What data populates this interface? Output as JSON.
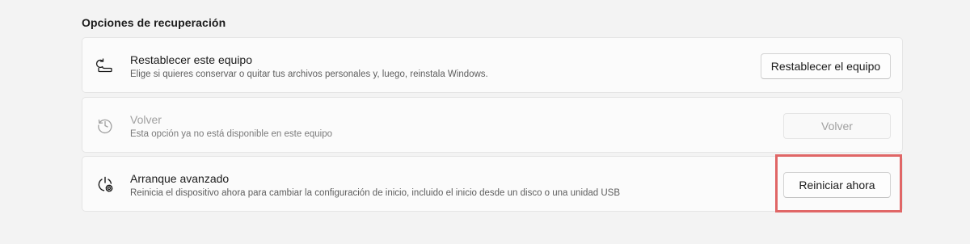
{
  "section": {
    "title": "Opciones de recuperación"
  },
  "cards": [
    {
      "icon": "reset-pc-icon",
      "title": "Restablecer este equipo",
      "description": "Elige si quieres conservar o quitar tus archivos personales y, luego, reinstala Windows.",
      "button_label": "Restablecer el equipo",
      "enabled": true
    },
    {
      "icon": "history-icon",
      "title": "Volver",
      "description": "Esta opción ya no está disponible en este equipo",
      "button_label": "Volver",
      "enabled": false
    },
    {
      "icon": "advanced-startup-icon",
      "title": "Arranque avanzado",
      "description": "Reinicia el dispositivo ahora para cambiar la configuración de inicio, incluido el inicio desde un disco o una unidad USB",
      "button_label": "Reiniciar ahora",
      "enabled": true
    }
  ],
  "highlight": {
    "color": "#e06666",
    "target": "Reiniciar ahora"
  },
  "colors": {
    "background": "#f3f3f3",
    "card": "#fbfbfb",
    "disabled_text": "#a0a0a0"
  }
}
